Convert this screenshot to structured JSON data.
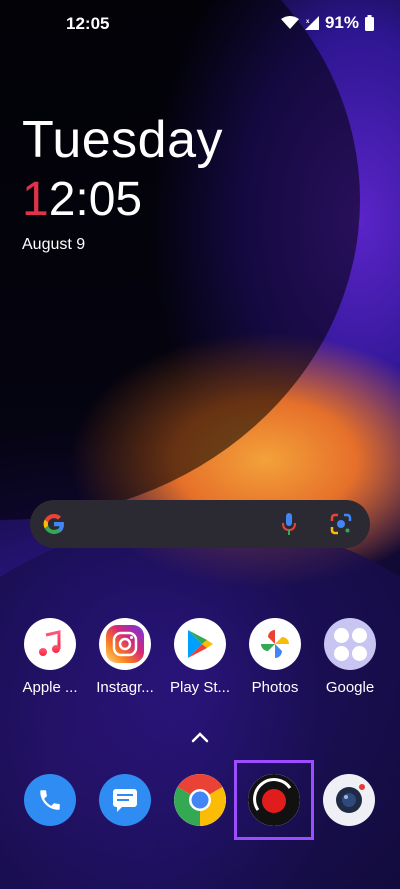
{
  "status": {
    "time": "12:05",
    "battery": "91%"
  },
  "clock": {
    "day": "Tuesday",
    "time_first": "1",
    "time_rest": "2:05",
    "date": "August 9"
  },
  "search": {
    "google_icon": "google-g-icon",
    "mic_icon": "microphone-icon",
    "lens_icon": "lens-icon"
  },
  "apps": [
    {
      "label": "Apple ...",
      "icon": "apple-music-icon"
    },
    {
      "label": "Instagr...",
      "icon": "instagram-icon"
    },
    {
      "label": "Play St...",
      "icon": "play-store-icon"
    },
    {
      "label": "Photos",
      "icon": "photos-icon"
    },
    {
      "label": "Google",
      "icon": "google-folder-icon"
    }
  ],
  "dock": [
    {
      "icon": "phone-icon"
    },
    {
      "icon": "messages-icon"
    },
    {
      "icon": "chrome-icon"
    },
    {
      "icon": "screen-recorder-icon"
    },
    {
      "icon": "camera-icon"
    }
  ],
  "colors": {
    "accent_red": "#e0334b",
    "highlight": "#9b4dff",
    "search_bg": "#2b2a33"
  }
}
